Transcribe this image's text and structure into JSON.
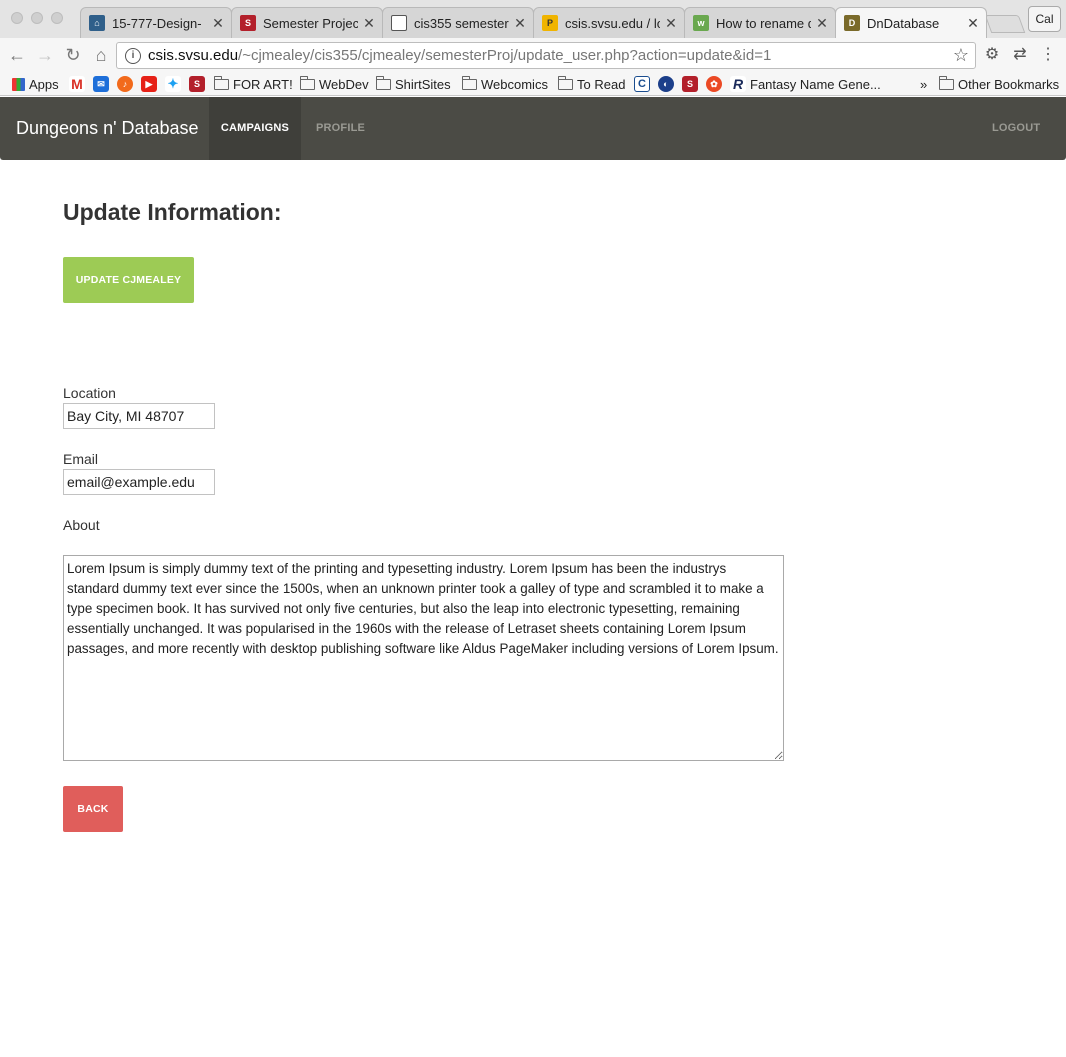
{
  "browser": {
    "tabs": [
      {
        "title": "15-777-Design-",
        "favicon": "museum-icon",
        "active": false
      },
      {
        "title": "Semester Project",
        "favicon": "svsu-icon",
        "active": false
      },
      {
        "title": "cis355 semester",
        "favicon": "document-icon",
        "active": false
      },
      {
        "title": "csis.svsu.edu / lo",
        "favicon": "phpmyadmin-icon",
        "active": false
      },
      {
        "title": "How to rename d",
        "favicon": "wikihow-icon",
        "active": false
      },
      {
        "title": "DnDatabase",
        "favicon": "dndatabase-icon",
        "active": true
      }
    ],
    "profile_label": "Cal",
    "address": {
      "host": "csis.svsu.edu",
      "path": "/~cjmealey/cis355/cjmealey/semesterProj/update_user.php?action=update&id=1"
    },
    "bookmarks": [
      {
        "label": "Apps",
        "type": "apps"
      },
      {
        "label": "",
        "type": "gmail"
      },
      {
        "label": "",
        "type": "mail"
      },
      {
        "label": "",
        "type": "music"
      },
      {
        "label": "",
        "type": "youtube"
      },
      {
        "label": "",
        "type": "twitter"
      },
      {
        "label": "",
        "type": "svsu"
      },
      {
        "label": "FOR ART!",
        "type": "folder"
      },
      {
        "label": "WebDev",
        "type": "folder"
      },
      {
        "label": "ShirtSites",
        "type": "folder"
      },
      {
        "label": "Webcomics",
        "type": "folder"
      },
      {
        "label": "To Read",
        "type": "folder"
      },
      {
        "label": "Fantasy Name Gene...",
        "type": "link"
      },
      {
        "label": "»",
        "type": "overflow"
      },
      {
        "label": "Other Bookmarks",
        "type": "folder"
      }
    ]
  },
  "navbar": {
    "brand": "Dungeons n' Database",
    "items": [
      "CAMPAIGNS",
      "PROFILE"
    ],
    "active": "CAMPAIGNS",
    "logout": "LOGOUT"
  },
  "page": {
    "title": "Update Information:",
    "update_button": "UPDATE CJMEALEY",
    "location": {
      "label": "Location",
      "value": "Bay City, MI 48707"
    },
    "email": {
      "label": "Email",
      "value": "email@example.edu"
    },
    "about": {
      "label": "About",
      "value": "Lorem Ipsum is simply dummy text of the printing and typesetting industry. Lorem Ipsum has been the industrys standard dummy text ever since the 1500s, when an unknown printer took a galley of type and scrambled it to make a type specimen book. It has survived not only five centuries, but also the leap into electronic typesetting, remaining essentially unchanged. It was popularised in the 1960s with the release of Letraset sheets containing Lorem Ipsum passages, and more recently with desktop publishing software like Aldus PageMaker including versions of Lorem Ipsum."
    },
    "back_button": "BACK"
  },
  "colors": {
    "navbar": "#4b4b45",
    "update_button": "#9dcb55",
    "back_button": "#e05e5b"
  }
}
